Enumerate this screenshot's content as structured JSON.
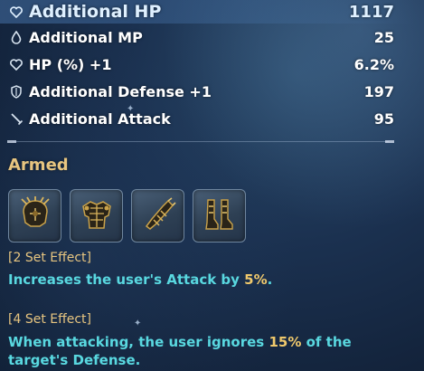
{
  "colors": {
    "label_text": "#ffffff",
    "set_name": "#e7c580",
    "effect_title": "#e7c580",
    "effect_text": "#59d8e0",
    "effect_highlight": "#f0c96c"
  },
  "stats": [
    {
      "icon": "heart-icon",
      "label": "Additional HP",
      "value": "1117"
    },
    {
      "icon": "drop-icon",
      "label": "Additional MP",
      "value": "25"
    },
    {
      "icon": "heart-icon",
      "label": "HP (%) +1",
      "value": "6.2%"
    },
    {
      "icon": "shield-icon",
      "label": "Additional Defense +1",
      "value": "197"
    },
    {
      "icon": "sword-icon",
      "label": "Additional Attack",
      "value": "95"
    }
  ],
  "set": {
    "name": "Armed",
    "items": [
      {
        "icon": "helmet-icon"
      },
      {
        "icon": "chest-armor-icon"
      },
      {
        "icon": "gauntlet-icon"
      },
      {
        "icon": "boots-icon"
      }
    ],
    "effects": [
      {
        "title": "[2 Set Effect]",
        "parts": [
          "Increases the user's Attack by ",
          "5%",
          "."
        ]
      },
      {
        "title": "[4 Set Effect]",
        "line1": [
          "When attacking, the user ignores ",
          "15%",
          " of the"
        ],
        "line2": "target's Defense."
      }
    ]
  }
}
